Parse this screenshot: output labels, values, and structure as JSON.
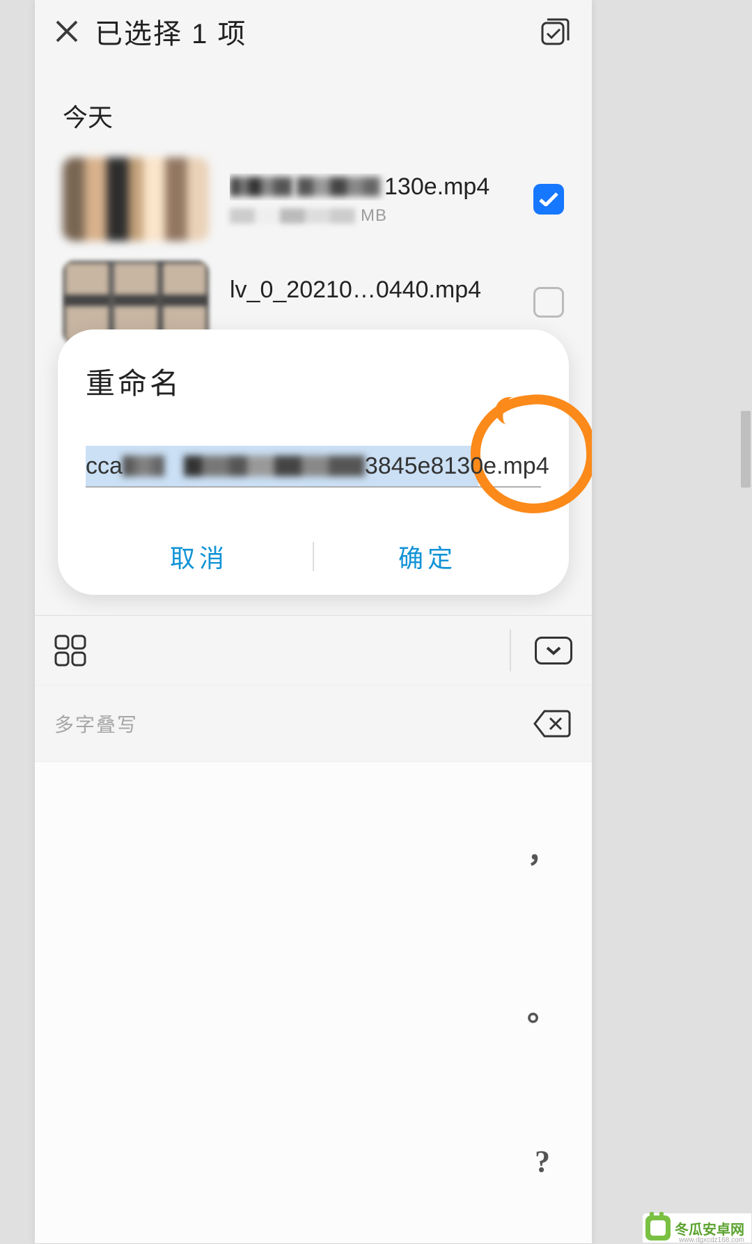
{
  "header": {
    "title": "已选择 1 项"
  },
  "section_today": "今天",
  "files": [
    {
      "name_suffix": "130e.mp4",
      "meta_suffix": "MB",
      "selected": true
    },
    {
      "name": "lv_0_20210…0440.mp4",
      "selected": false
    }
  ],
  "dialog": {
    "title": "重命名",
    "input_prefix": "cca",
    "input_mid": "3845e8130e",
    "input_ext": ".mp4",
    "cancel": "取消",
    "ok": "确定"
  },
  "keyboard": {
    "hint": "多字叠写",
    "puncts": [
      "，",
      "。",
      "?"
    ]
  },
  "watermark": {
    "text": "冬瓜安卓网",
    "url": "www.dgxcdz168.com"
  }
}
